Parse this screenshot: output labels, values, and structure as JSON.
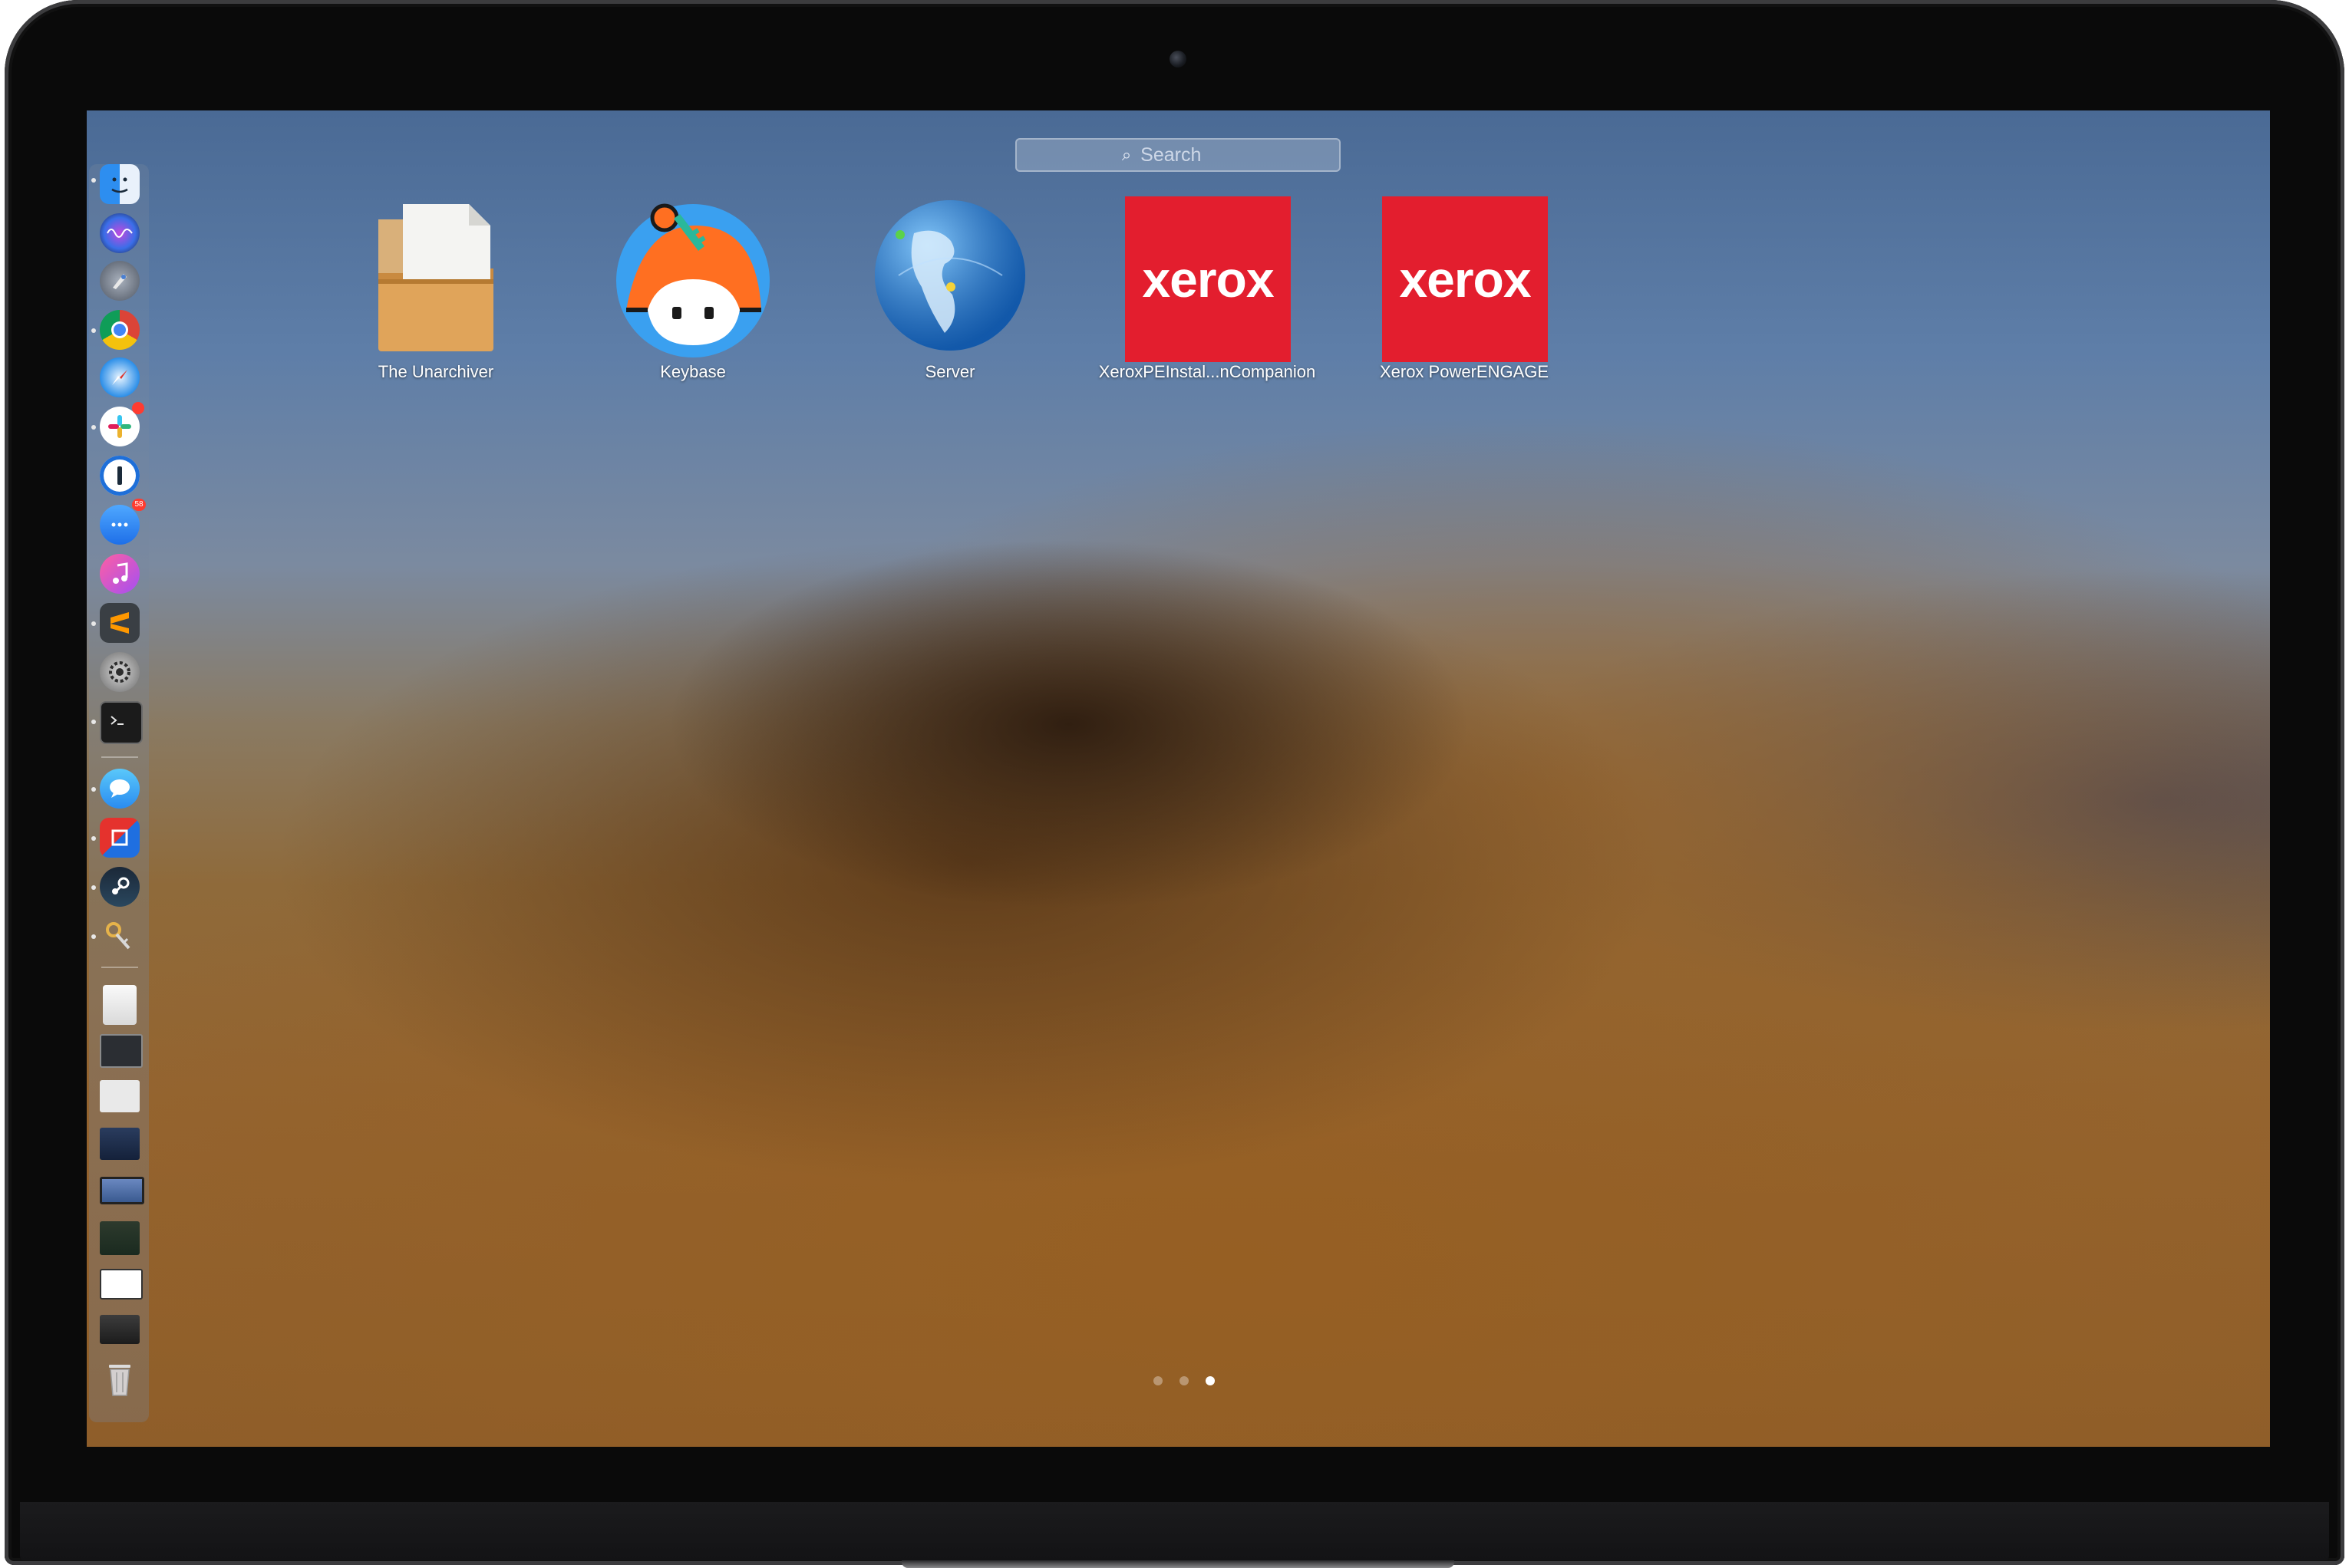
{
  "search": {
    "placeholder": "Search"
  },
  "apps": [
    {
      "label": "The Unarchiver",
      "icon": "unarchiver-box-icon"
    },
    {
      "label": "Keybase",
      "icon": "keybase-icon"
    },
    {
      "label": "Server",
      "icon": "server-globe-icon"
    },
    {
      "label": "XeroxPEInstal...nCompanion",
      "icon": "xerox-icon",
      "logo_text": "xerox"
    },
    {
      "label": "Xerox PowerENGAGE",
      "icon": "xerox-icon",
      "logo_text": "xerox"
    }
  ],
  "pagination": {
    "pages": 3,
    "current": 3
  },
  "colors": {
    "xerox_red": "#e31e2e",
    "wallpaper_sky": "#5e7ea8",
    "wallpaper_sand": "#946430"
  },
  "dock": {
    "items": [
      "finder-icon",
      "siri-icon",
      "launchpad-icon",
      "chrome-icon",
      "safari-icon",
      "slack-icon",
      "1password-icon",
      "messenger-icon",
      "itunes-icon",
      "sublime-text-icon",
      "system-preferences-icon",
      "terminal-icon",
      "messages-icon",
      "parallels-icon",
      "steam-icon",
      "keychain-icon",
      "documents-folder-icon",
      "window-thumbnail-icon",
      "window-thumbnail-icon",
      "window-thumbnail-icon",
      "window-thumbnail-icon",
      "window-thumbnail-icon",
      "window-thumbnail-icon",
      "window-thumbnail-icon",
      "trash-icon"
    ],
    "badges": {
      "slack": "",
      "messenger": "58"
    }
  }
}
